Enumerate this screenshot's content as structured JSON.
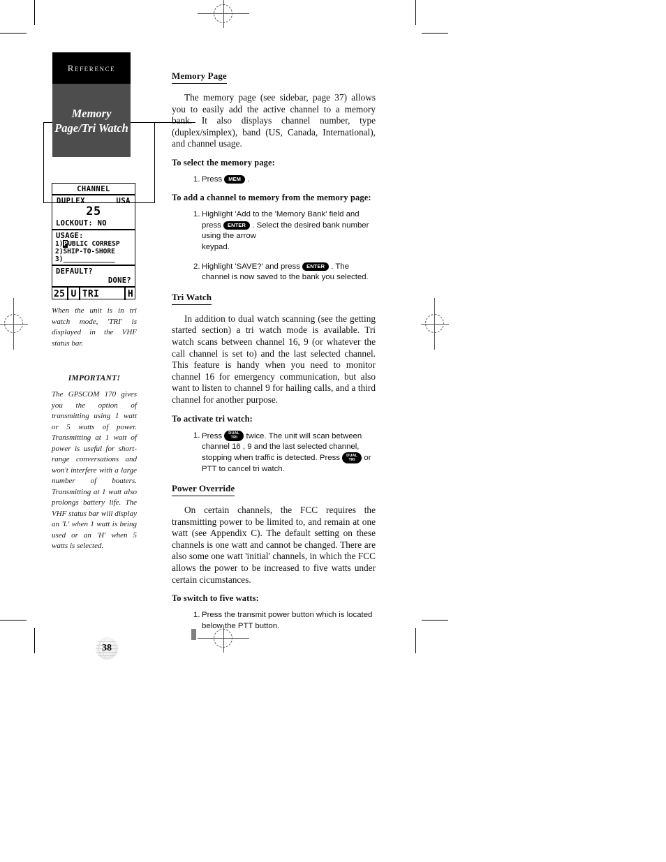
{
  "sidebar": {
    "tab_reference": "Reference",
    "tab_title_line1": "Memory",
    "tab_title_line2": "Page/Tri Watch",
    "lcd": {
      "title": "CHANNEL",
      "type": "DUPLEX",
      "band": "USA",
      "channel": "25",
      "lockout": "LOCKOUT: NO",
      "usage_label": "USAGE:",
      "usage_1_prefix": "1)",
      "usage_1_highlight": "P",
      "usage_1_rest": "UBLIC CORRESP",
      "usage_2": "2)SHIP-TO-SHORE",
      "usage_3": "3)_____________",
      "default": "DEFAULT?",
      "done": "DONE?",
      "status_channel": "25",
      "status_band": "U",
      "status_mode": "TRI",
      "status_power": "H"
    },
    "caption_tri": "When the unit is in tri watch mode, 'TRI' is displayed in the VHF status bar.",
    "important_heading": "IMPORTANT!",
    "caption_important": "The GPSCOM 170 gives you the option of transmitting using 1 watt or 5 watts of power. Transmitting at 1 watt of power is useful for short-range conversations and won't interfere with a large number of boaters. Transmitting at 1 watt also prolongs battery life. The VHF status bar will display an 'L' when 1 watt is being used or an 'H' when 5 watts is selected.",
    "page_number": "38"
  },
  "main": {
    "memory_page": {
      "heading": "Memory Page",
      "body": "The memory page (see sidebar, page 37) allows you to easily add the active channel to a memory bank. It also displays channel number, type (duplex/simplex), band (US, Canada, International), and channel usage.",
      "proc_select_heading": "To select the memory page:",
      "step_select_num": "1.",
      "step_select_a": "Press",
      "step_select_key": "MEM",
      "step_select_b": ".",
      "proc_add_heading": "To add a channel to memory from the memory page:",
      "add_step1_num": "1.",
      "add_step1_a": "Highlight 'Add to the 'Memory Bank' field and press",
      "add_step1_key": "ENTER",
      "add_step1_b": ". Select the desired bank number using the arrow",
      "add_step1_c": "keypad.",
      "add_step2_num": "2.",
      "add_step2_a": "Highlight 'SAVE?' and press",
      "add_step2_key": "ENTER",
      "add_step2_b": ". The channel is now saved to the bank you selected."
    },
    "tri_watch": {
      "heading": "Tri Watch",
      "body": "In addition to dual watch scanning (see the getting started section) a tri watch mode is available. Tri watch scans between channel 16, 9 (or whatever the call channel is set to) and the last selected channel. This feature is handy when you need to monitor channel 16 for emergency communication, but also want to listen to channel 9 for hailing calls, and a third channel for another purpose.",
      "proc_heading": "To activate tri watch:",
      "step1_num": "1.",
      "step1_a": "Press",
      "step1_key1_line1": "DUAL",
      "step1_key1_line2": "TRI",
      "step1_b": "twice. The unit will scan between channel 16 , 9 and the last selected channel, stopping when traffic is detected. Press",
      "step1_key2_line1": "DUAL",
      "step1_key2_line2": "TRI",
      "step1_c": "or PTT to cancel tri watch."
    },
    "power_override": {
      "heading": "Power Override",
      "body": "On certain channels, the FCC requires the transmitting power to be limited to, and remain at one watt (see Appendix C). The default setting on these channels is one watt and cannot be changed. There are also some one watt 'initial' channels, in which the FCC allows the power to be increased to five watts under certain cicumstances.",
      "proc_heading": "To switch to five watts:",
      "step1_num": "1.",
      "step1_text": "Press the transmit power button which is located below the PTT button."
    }
  }
}
